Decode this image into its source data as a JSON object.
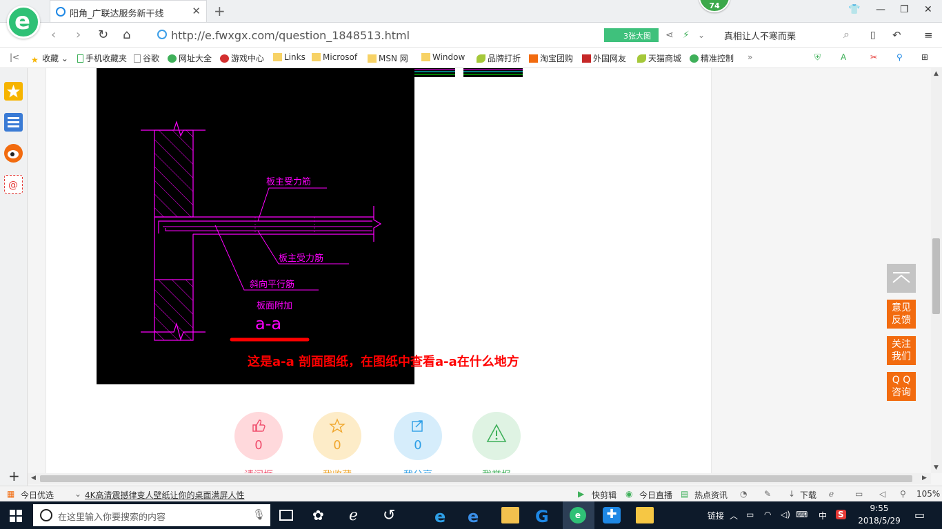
{
  "browser": {
    "tab_title": "阳角_广联达服务新干线",
    "url": "http://e.fwxgx.com/question_1848513.html",
    "badge_number": "74",
    "big_image_label": "3张大图",
    "search_text": "真相让人不寒而栗"
  },
  "bookmarks": [
    {
      "label": "收藏"
    },
    {
      "label": "手机收藏夹"
    },
    {
      "label": "谷歌"
    },
    {
      "label": "网址大全"
    },
    {
      "label": "游戏中心"
    },
    {
      "label": "Links"
    },
    {
      "label": "Microsof"
    },
    {
      "label": "MSN 网"
    },
    {
      "label": "Window"
    },
    {
      "label": "品牌打折"
    },
    {
      "label": "淘宝团购"
    },
    {
      "label": "外国网友"
    },
    {
      "label": "天猫商城"
    },
    {
      "label": "精准控制"
    }
  ],
  "drawing": {
    "label_main_rebar_top": "板主受力筋",
    "label_main_rebar_bottom": "板主受力筋",
    "label_diag_rebar": "斜向平行筋",
    "label_additional": "板面附加",
    "section_name": "a-a"
  },
  "caption_parts": [
    "这是",
    "a-a",
    " 剖面图纸，在图纸中查看",
    "a-a",
    "在什么地方"
  ],
  "actions": [
    {
      "count": "0",
      "color": "#ffd9dc",
      "text_color": "#f0506e",
      "label": "请问框"
    },
    {
      "count": "0",
      "color": "#fdecc8",
      "text_color": "#f0a830",
      "label": "我收藏"
    },
    {
      "count": "0",
      "color": "#d6edfb",
      "text_color": "#2e9fe6",
      "label": "我分享"
    },
    {
      "count": "",
      "color": "#dff3e3",
      "text_color": "#3fb05a",
      "label": "我举报"
    }
  ],
  "floating": {
    "feedback": "意见\n反馈",
    "follow": "关注\n我们",
    "qq": "Q Q\n咨询"
  },
  "statusbar": {
    "today": "今日优选",
    "news": "4K高清震撼律变人壁纸让你的桌面满屏人性",
    "kuaijian": "快剪辑",
    "zhibo": "今日直播",
    "redian": "热点资讯",
    "xiazai": "下载",
    "zoom": "105%"
  },
  "taskbar": {
    "search_placeholder": "在这里输入你要搜索的内容",
    "links": "链接",
    "ime": "中",
    "time": "9:55",
    "date": "2018/5/29"
  }
}
